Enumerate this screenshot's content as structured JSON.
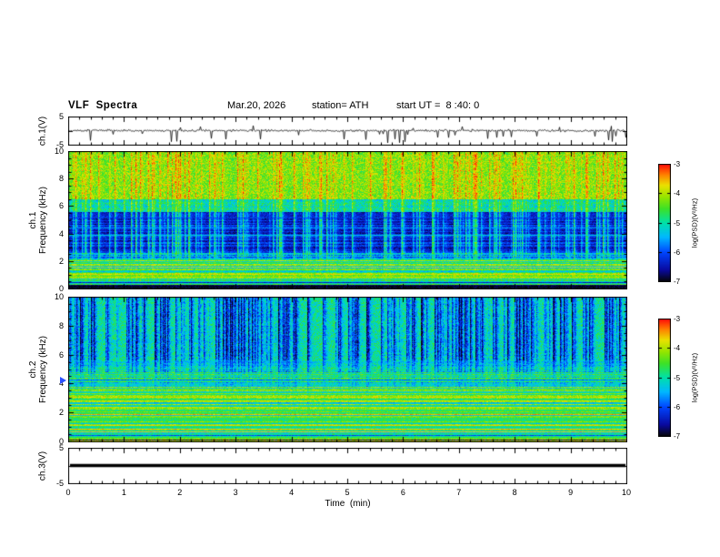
{
  "figure": {
    "title": "VLF  Spectra",
    "date": "Mar.20, 2026",
    "station": "station= ATH",
    "start_ut": "start UT =  8 :40: 0"
  },
  "xaxis": {
    "label": "Time  (min)",
    "lim": [
      0,
      10
    ],
    "major_ticks": [
      0,
      1,
      2,
      3,
      4,
      5,
      6,
      7,
      8,
      9,
      10
    ],
    "minor_step": 0.2
  },
  "colormap": {
    "clim": [
      -7,
      -3
    ],
    "stops": [
      [
        0.0,
        [
          5,
          5,
          5
        ]
      ],
      [
        0.1,
        [
          10,
          10,
          160
        ]
      ],
      [
        0.25,
        [
          0,
          70,
          255
        ]
      ],
      [
        0.38,
        [
          0,
          185,
          255
        ]
      ],
      [
        0.5,
        [
          0,
          225,
          170
        ]
      ],
      [
        0.62,
        [
          60,
          225,
          40
        ]
      ],
      [
        0.72,
        [
          150,
          230,
          0
        ]
      ],
      [
        0.82,
        [
          235,
          225,
          0
        ]
      ],
      [
        0.91,
        [
          255,
          130,
          0
        ]
      ],
      [
        1.0,
        [
          255,
          10,
          10
        ]
      ]
    ]
  },
  "chart_data": [
    {
      "id": "ch1-waveform",
      "type": "line",
      "ylabel": "ch.1(V)",
      "ylim": [
        -5,
        5
      ],
      "yticks": [
        5,
        0,
        -5
      ],
      "ytick_labels": [
        5,
        -5
      ],
      "baseline": 0,
      "noise_amp": 0.55,
      "neg_spike_rate": 0.05,
      "neg_spike_amp": 3.2,
      "pos_spike_rate": 0.02,
      "pos_spike_amp": 1.4,
      "color": "#000000",
      "description": "Broadband noisy ch.1 voltage trace centered near 0 V with frequent impulsive negative spikes reaching about -4 to -5 V"
    },
    {
      "id": "ch1-spectrogram",
      "type": "heatmap",
      "ylabel1": "ch.1",
      "ylabel2": "Frequency (kHz)",
      "ylim": [
        0,
        10
      ],
      "yticks": [
        0,
        2,
        4,
        6,
        8,
        10
      ],
      "clim": [
        -7,
        -3
      ],
      "streak_rate": 0.24,
      "streak_decay": 0.5,
      "bands": [
        {
          "f": [
            0,
            0.35
          ],
          "base": -6.9,
          "noise": 0.15,
          "streak": 0.15,
          "hline": 0.2
        },
        {
          "f": [
            0.35,
            2.15
          ],
          "base": -4.65,
          "noise": 0.35,
          "streak": 0.25,
          "hline": 0.75
        },
        {
          "f": [
            2.15,
            2.6
          ],
          "base": -5.7,
          "noise": 0.45,
          "streak": 0.9,
          "hline": 0.5
        },
        {
          "f": [
            2.6,
            5.6
          ],
          "base": -6.35,
          "noise": 0.3,
          "streak": 1.8,
          "hline": 0.3
        },
        {
          "f": [
            5.6,
            6.5
          ],
          "base": -5.1,
          "noise": 0.5,
          "streak": 1.0,
          "hline": 0.15
        },
        {
          "f": [
            6.5,
            10
          ],
          "base": -4.25,
          "noise": 0.5,
          "streak": 0.85,
          "hline": 0.08
        }
      ],
      "hlines": [
        {
          "f": 0.5,
          "level": -6.4
        },
        {
          "f": 0.95,
          "level": -4.15
        },
        {
          "f": 1.55,
          "level": -5.4
        },
        {
          "f": 2.05,
          "level": -5.1
        },
        {
          "f": 3.95,
          "level": -5.3
        },
        {
          "f": 4.5,
          "level": -5.6
        },
        {
          "f": 5.2,
          "level": -6.0
        }
      ],
      "colorbar": {
        "label": "log(PSD)(V²/Hz)",
        "ticks": [
          -3,
          -4,
          -5,
          -6,
          -7
        ]
      },
      "description": "ch.1 spectrogram 0-10 kHz: yellow-green noisy band above ~6.5 kHz with occasional red specks, dark blue 2.6-5.6 kHz band crossed by bright vertical sferic streaks, green/cyan banded structure below ~2 kHz, near-black band at 0-0.3 kHz"
    },
    {
      "id": "ch2-spectrogram",
      "type": "heatmap",
      "ylabel1": "ch.2",
      "ylabel2": "Frequency (kHz)",
      "ylim": [
        0,
        10
      ],
      "yticks": [
        0,
        2,
        4,
        6,
        8,
        10
      ],
      "clim": [
        -7,
        -3
      ],
      "streak_rate": 0.3,
      "streak_decay": 0.6,
      "bands": [
        {
          "f": [
            0,
            0.5
          ],
          "base": -4.75,
          "noise": 0.3,
          "streak": -0.05,
          "hline": 1.0
        },
        {
          "f": [
            0.5,
            2.25
          ],
          "base": -4.5,
          "noise": 0.3,
          "streak": -0.1,
          "hline": 0.85
        },
        {
          "f": [
            2.25,
            3.8
          ],
          "base": -4.55,
          "noise": 0.35,
          "streak": -0.2,
          "hline": 0.8
        },
        {
          "f": [
            3.8,
            4.8
          ],
          "base": -4.85,
          "noise": 0.4,
          "streak": -0.5,
          "hline": 0.55
        },
        {
          "f": [
            4.8,
            5.6
          ],
          "base": -4.95,
          "noise": 0.45,
          "streak": -1.1,
          "hline": 0.3
        },
        {
          "f": [
            5.6,
            10
          ],
          "base": -4.95,
          "noise": 0.5,
          "streak": -2.0,
          "hline": 0.1
        }
      ],
      "hlines": [
        {
          "f": 0.18,
          "level": -6.8
        },
        {
          "f": 0.5,
          "level": -6.0
        },
        {
          "f": 1.3,
          "level": -5.3
        },
        {
          "f": 1.95,
          "level": -3.5
        },
        {
          "f": 2.1,
          "level": -4.3
        },
        {
          "f": 2.85,
          "level": -3.9
        },
        {
          "f": 3.4,
          "level": -4.2
        },
        {
          "f": 4.3,
          "level": -5.8
        }
      ],
      "colorbar": {
        "label": "log(PSD)(V²/Hz)",
        "ticks": [
          -3,
          -4,
          -5,
          -6,
          -7
        ]
      },
      "description": "ch.2 spectrogram 0-10 kHz: green/cyan background above ~5 kHz densely crossed by dark blue vertical streaks, horizontally banded green region below ~4 kHz with red/yellow power-line harmonics near 2 and 3 kHz and dark lines near 0.2 kHz"
    },
    {
      "id": "ch3-waveform",
      "type": "line",
      "ylabel": "ch.3(V)",
      "ylim": [
        -5,
        5
      ],
      "yticks": [
        5,
        0,
        -5
      ],
      "ytick_labels": [
        5,
        -5
      ],
      "flat_value": 0,
      "line_width": 3.5,
      "color": "#000000",
      "description": "ch.3 voltage trace: flat thick black line at 0 V (no signal)"
    }
  ],
  "markers": [
    {
      "panel": "spec2",
      "freq": 4.2,
      "color": "#2b50ff"
    }
  ]
}
